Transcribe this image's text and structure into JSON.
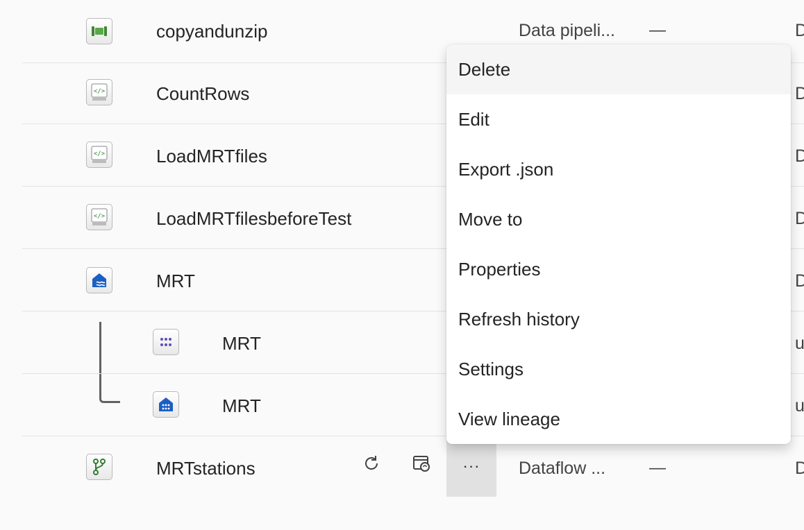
{
  "rows": [
    {
      "name": "copyandunzip",
      "type": "Data pipeli...",
      "dash": "—",
      "edge": "D",
      "icon": "pipeline-icon"
    },
    {
      "name": "CountRows",
      "edge": "D",
      "icon": "notebook-icon"
    },
    {
      "name": "LoadMRTfiles",
      "edge": "D",
      "icon": "notebook-icon"
    },
    {
      "name": "LoadMRTfilesbeforeTest",
      "edge": "D",
      "icon": "notebook-icon"
    },
    {
      "name": "MRT",
      "edge": "D",
      "icon": "lakehouse-icon"
    },
    {
      "name": "MRT",
      "edge": "u",
      "icon": "semantic-model-icon"
    },
    {
      "name": "MRT",
      "edge": "u",
      "icon": "sql-endpoint-icon"
    },
    {
      "name": "MRTstations",
      "type": "Dataflow ...",
      "dash": "—",
      "edge": "D",
      "icon": "dataflow-icon"
    }
  ],
  "row_actions": {
    "refresh_icon": "refresh-icon",
    "schedule_icon": "schedule-refresh-icon",
    "more_label": "···"
  },
  "context_menu": {
    "items": [
      "Delete",
      "Edit",
      "Export .json",
      "Move to",
      "Properties",
      "Refresh history",
      "Settings",
      "View lineage"
    ],
    "hovered": "Delete"
  },
  "colors": {
    "pipeline": "#3a8a2e",
    "notebook": "#2f7d32",
    "lakehouse": "#1c5fc4",
    "semantic": "#5b4fb8",
    "menu_hover": "#f5f5f5"
  }
}
